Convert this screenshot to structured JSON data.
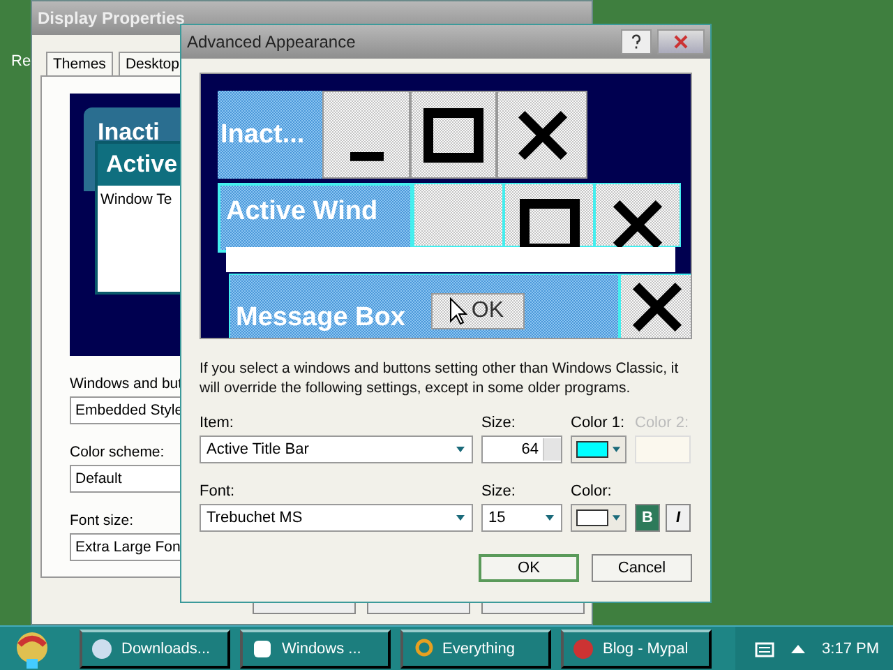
{
  "desktop": {
    "icon_labels": [
      "Re"
    ]
  },
  "display_properties": {
    "title": "Display Properties",
    "tabs": [
      {
        "label": "Themes",
        "selected": false
      },
      {
        "label": "Desktop",
        "selected": false
      }
    ],
    "preview": {
      "inactive_title": "Inacti",
      "active_title": "Active",
      "window_text": "Window Te"
    },
    "fields": [
      {
        "label": "Windows and but",
        "value": "Embedded Style"
      },
      {
        "label": "Color scheme:",
        "value": "Default"
      },
      {
        "label": "Font size:",
        "value": "Extra Large Fon"
      }
    ]
  },
  "advanced_appearance": {
    "title": "Advanced Appearance",
    "preview": {
      "inactive_title": "Inact...",
      "active_title": "Active Wind",
      "message_box_title": "Message Box",
      "button_label": "OK"
    },
    "note": "If you select a windows and buttons setting other than Windows Classic, it will override the following settings, except in some older programs.",
    "item": {
      "label": "Item:",
      "value": "Active Title Bar"
    },
    "item_size": {
      "label": "Size:",
      "value": "64"
    },
    "color1": {
      "label": "Color 1:",
      "color": "#00ffff"
    },
    "color2": {
      "label": "Color 2:",
      "disabled": true
    },
    "font": {
      "label": "Font:",
      "value": "Trebuchet MS"
    },
    "font_size": {
      "label": "Size:",
      "value": "15"
    },
    "font_color": {
      "label": "Color:",
      "color": "#ffffff"
    },
    "style_buttons": [
      {
        "label": "B",
        "on": true
      },
      {
        "label": "I",
        "on": false
      }
    ],
    "buttons": [
      "OK",
      "Cancel"
    ]
  },
  "taskbar": {
    "items": [
      {
        "label": "Downloads...",
        "selected": false
      },
      {
        "label": "Windows ...",
        "selected": false
      },
      {
        "label": "Everything",
        "selected": false
      },
      {
        "label": "Blog - Mypal",
        "selected": false
      }
    ],
    "clock": "3:17 PM"
  }
}
